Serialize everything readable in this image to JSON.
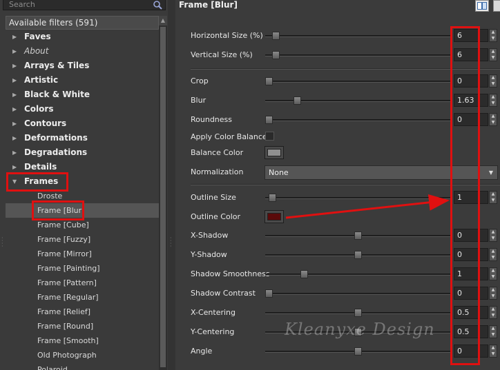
{
  "search": {
    "placeholder": "Search"
  },
  "filters": {
    "header": "Available filters (591)",
    "items": [
      {
        "label": "Faves",
        "kind": "cat"
      },
      {
        "label": "About",
        "kind": "cat-italic"
      },
      {
        "label": "Arrays & Tiles",
        "kind": "cat"
      },
      {
        "label": "Artistic",
        "kind": "cat"
      },
      {
        "label": "Black & White",
        "kind": "cat"
      },
      {
        "label": "Colors",
        "kind": "cat"
      },
      {
        "label": "Contours",
        "kind": "cat"
      },
      {
        "label": "Deformations",
        "kind": "cat"
      },
      {
        "label": "Degradations",
        "kind": "cat"
      },
      {
        "label": "Details",
        "kind": "cat"
      },
      {
        "label": "Frames",
        "kind": "cat-open"
      },
      {
        "label": "Droste",
        "kind": "sub"
      },
      {
        "label": "Frame [Blur]",
        "kind": "sub-selected"
      },
      {
        "label": "Frame [Cube]",
        "kind": "sub"
      },
      {
        "label": "Frame [Fuzzy]",
        "kind": "sub"
      },
      {
        "label": "Frame [Mirror]",
        "kind": "sub"
      },
      {
        "label": "Frame [Painting]",
        "kind": "sub"
      },
      {
        "label": "Frame [Pattern]",
        "kind": "sub"
      },
      {
        "label": "Frame [Regular]",
        "kind": "sub"
      },
      {
        "label": "Frame [Relief]",
        "kind": "sub"
      },
      {
        "label": "Frame [Round]",
        "kind": "sub"
      },
      {
        "label": "Frame [Smooth]",
        "kind": "sub"
      },
      {
        "label": "Old Photograph",
        "kind": "sub"
      },
      {
        "label": "Polaroid",
        "kind": "sub"
      }
    ]
  },
  "panel": {
    "title": "Frame [Blur]",
    "params": [
      {
        "id": "horizontal-size",
        "label": "Horizontal Size (%)",
        "type": "slider",
        "value": "6",
        "level": 0.04
      },
      {
        "id": "vertical-size",
        "label": "Vertical Size (%)",
        "type": "slider",
        "value": "6",
        "level": 0.04
      },
      {
        "type": "separator"
      },
      {
        "id": "crop",
        "label": "Crop",
        "type": "slider",
        "value": "0",
        "level": 0.0
      },
      {
        "id": "blur",
        "label": "Blur",
        "type": "slider",
        "value": "1.63",
        "level": 0.16
      },
      {
        "id": "roundness",
        "label": "Roundness",
        "type": "slider",
        "value": "0",
        "level": 0.0
      },
      {
        "id": "apply-color-balance",
        "label": "Apply Color Balance",
        "type": "checkbox",
        "checked": false
      },
      {
        "id": "balance-color",
        "label": "Balance Color",
        "type": "color",
        "color": "#8f8f8f"
      },
      {
        "id": "normalization",
        "label": "Normalization",
        "type": "select",
        "value": "None"
      },
      {
        "type": "separator"
      },
      {
        "id": "outline-size",
        "label": "Outline Size",
        "type": "slider",
        "value": "1",
        "level": 0.02
      },
      {
        "id": "outline-color",
        "label": "Outline Color",
        "type": "color",
        "color": "#5a0a0a"
      },
      {
        "id": "x-shadow",
        "label": "X-Shadow",
        "type": "slider",
        "value": "0",
        "level": 0.5
      },
      {
        "id": "y-shadow",
        "label": "Y-Shadow",
        "type": "slider",
        "value": "0",
        "level": 0.5
      },
      {
        "id": "shadow-smoothness",
        "label": "Shadow Smoothness",
        "type": "slider",
        "value": "1",
        "level": 0.2
      },
      {
        "id": "shadow-contrast",
        "label": "Shadow Contrast",
        "type": "slider",
        "value": "0",
        "level": 0.0
      },
      {
        "id": "x-centering",
        "label": "X-Centering",
        "type": "slider",
        "value": "0.5",
        "level": 0.5
      },
      {
        "id": "y-centering",
        "label": "Y-Centering",
        "type": "slider",
        "value": "0.5",
        "level": 0.5
      },
      {
        "id": "angle",
        "label": "Angle",
        "type": "slider",
        "value": "0",
        "level": 0.5
      }
    ]
  },
  "watermark": "Kleanyxe Design",
  "colors": {
    "annotation": "#e01010",
    "background": "#3b3b3b"
  }
}
